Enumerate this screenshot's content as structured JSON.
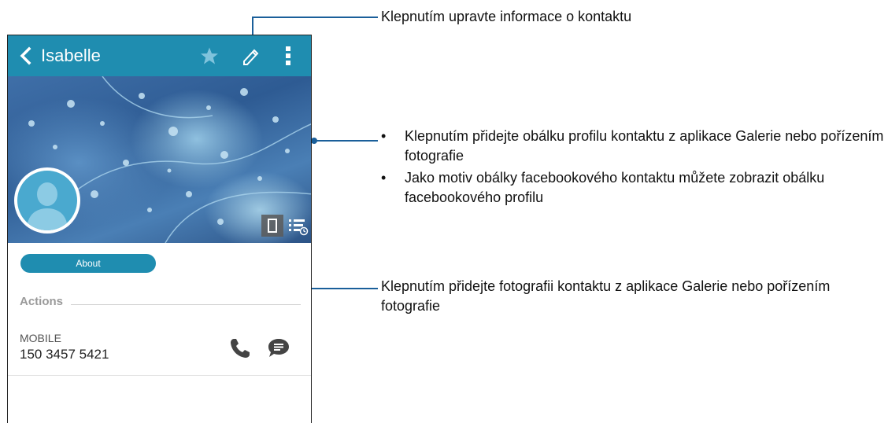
{
  "topbar": {
    "title": "Isabelle",
    "icons": [
      "back-icon",
      "star-icon",
      "edit-icon",
      "more-vert-icon"
    ],
    "color": "#1f8db0"
  },
  "cover": {
    "buttons": [
      "cover-phone-icon",
      "cover-list-icon"
    ]
  },
  "avatar": {
    "icon": "person-silhouette-icon"
  },
  "about": {
    "label": "About"
  },
  "actions": {
    "label": "Actions"
  },
  "contact": {
    "type_label": "MOBILE",
    "number": "150 3457 5421",
    "icons": [
      "call-icon",
      "message-icon"
    ]
  },
  "callouts": {
    "edit": "Klepnutím upravte informace o kontaktu",
    "cover_bullets": [
      "Klepnutím přidejte obálku profilu kontaktu z aplikace Galerie nebo pořízením fotografie",
      "Jako motiv obálky facebookového kontaktu můžete zobrazit obálku facebookového profilu"
    ],
    "bullet": "•",
    "photo": "Klepnutím přidejte fotografii kontaktu z aplikace Galerie nebo pořízením fotografie"
  },
  "colors": {
    "accent": "#1f8db0",
    "callout_line": "#1a5f9a"
  }
}
